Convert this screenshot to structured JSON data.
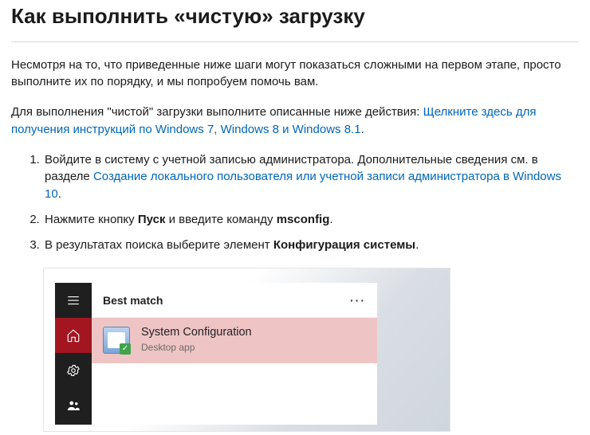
{
  "title": "Как выполнить «чистую» загрузку",
  "intro": "Несмотря на то, что приведенные ниже шаги могут показаться сложными на первом этапе, просто выполните их по порядку, и мы попробуем помочь вам.",
  "line2_lead": "Для выполнения \"чистой\" загрузки выполните описанные ниже действия:  ",
  "line2_link": "Щелкните здесь для получения инструкций по Windows 7, Windows 8 и Windows 8.1",
  "line2_tail": ".",
  "steps": {
    "s1_a": "Войдите в систему с учетной записью администратора.  Дополнительные сведения см. в разделе ",
    "s1_link": "Создание локального пользователя или учетной записи администратора в Windows 10",
    "s1_b": ".",
    "s2_a": "Нажмите кнопку ",
    "s2_b1": "Пуск",
    "s2_c": " и введите команду ",
    "s2_b2": "msconfig",
    "s2_d": ".",
    "s3_a": "В результатах поиска выберите элемент ",
    "s3_b1": "Конфигурация системы",
    "s3_b": "."
  },
  "start_menu": {
    "best_match": "Best match",
    "more": "···",
    "result": {
      "title": "System Configuration",
      "subtitle": "Desktop app"
    }
  }
}
